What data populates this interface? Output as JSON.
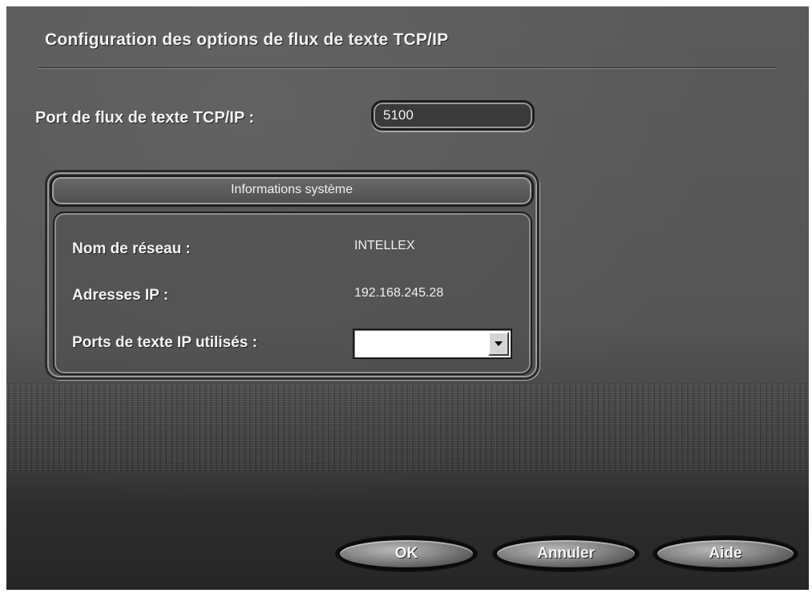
{
  "dialog": {
    "title": "Configuration des options de flux de texte TCP/IP"
  },
  "port": {
    "label": "Port de flux de texte TCP/IP :",
    "value": "5100"
  },
  "system_info": {
    "title": "Informations système",
    "network_name_label": "Nom de réseau :",
    "network_name_value": "INTELLEX",
    "ip_label": "Adresses IP :",
    "ip_value": "192.168.245.28",
    "ports_label": "Ports de texte IP utilisés :",
    "ports_selected": ""
  },
  "buttons": {
    "ok": "OK",
    "cancel": "Annuler",
    "help": "Aide"
  },
  "icons": {
    "dropdown": "chevron-down-icon"
  }
}
